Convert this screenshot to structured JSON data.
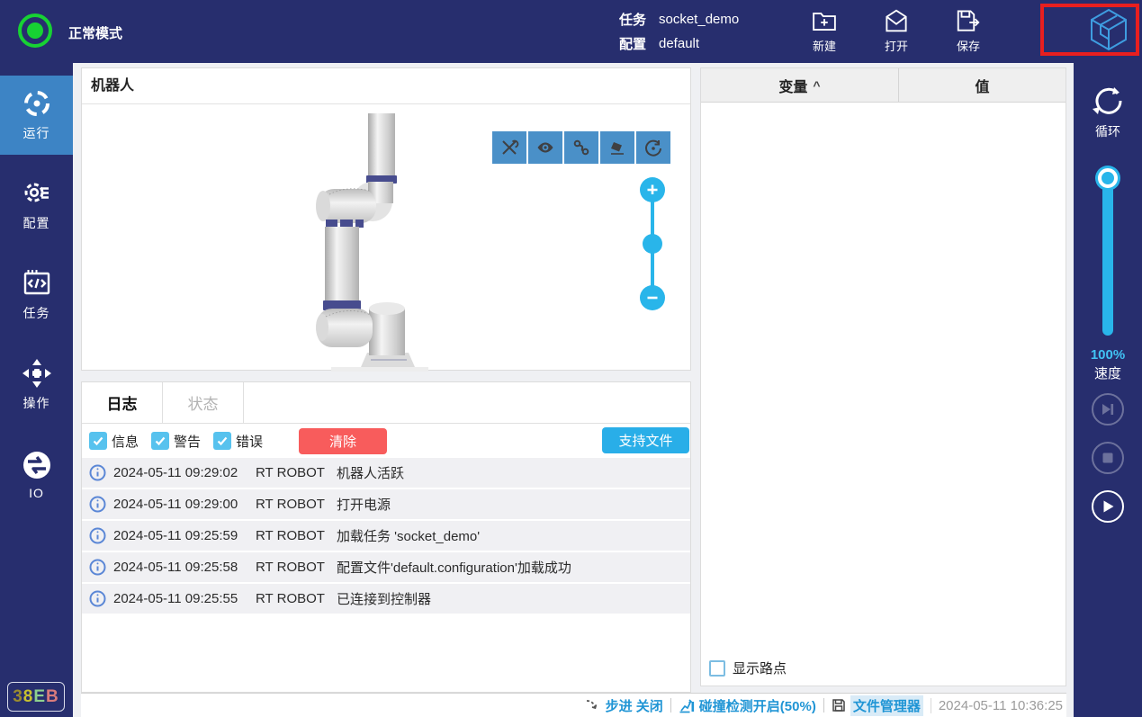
{
  "topbar": {
    "mode_label": "正常模式",
    "task_label": "任务",
    "task_value": "socket_demo",
    "config_label": "配置",
    "config_value": "default",
    "actions": [
      {
        "label": "新建"
      },
      {
        "label": "打开"
      },
      {
        "label": "保存"
      }
    ]
  },
  "sidebar": {
    "items": [
      {
        "label": "运行",
        "active": true
      },
      {
        "label": "配置",
        "active": false
      },
      {
        "label": "任务",
        "active": false
      },
      {
        "label": "操作",
        "active": false
      },
      {
        "label": "IO",
        "active": false
      }
    ],
    "code_chars": [
      {
        "ch": "3",
        "color": "#9a8b30"
      },
      {
        "ch": "8",
        "color": "#c9c22f"
      },
      {
        "ch": "E",
        "color": "#8ed08e"
      },
      {
        "ch": "B",
        "color": "#d97c7c"
      }
    ]
  },
  "robot_panel": {
    "title": "机器人",
    "toolbar_icons": [
      "tools",
      "eye",
      "path",
      "eraser",
      "rotate"
    ]
  },
  "log_panel": {
    "tabs": [
      {
        "label": "日志",
        "active": true
      },
      {
        "label": "状态",
        "active": false
      }
    ],
    "filters": [
      {
        "label": "信息",
        "checked": true
      },
      {
        "label": "警告",
        "checked": true
      },
      {
        "label": "错误",
        "checked": true
      }
    ],
    "clear_label": "清除",
    "support_label": "支持文件",
    "rows": [
      {
        "time": "2024-05-11 09:29:02",
        "source": "RT ROBOT",
        "message": "机器人活跃"
      },
      {
        "time": "2024-05-11 09:29:00",
        "source": "RT ROBOT",
        "message": "打开电源"
      },
      {
        "time": "2024-05-11 09:25:59",
        "source": "RT ROBOT",
        "message": "加载任务 'socket_demo'"
      },
      {
        "time": "2024-05-11 09:25:58",
        "source": "RT ROBOT",
        "message": "配置文件'default.configuration'加载成功"
      },
      {
        "time": "2024-05-11 09:25:55",
        "source": "RT ROBOT",
        "message": "已连接到控制器"
      }
    ]
  },
  "variables_panel": {
    "col_variable": "变量",
    "sort_indicator": "^",
    "col_value": "值",
    "show_waypoints_label": "显示路点",
    "show_waypoints_checked": false
  },
  "right_sidebar": {
    "loop_label": "循环",
    "speed_percent": "100%",
    "speed_label": "速度"
  },
  "statusbar": {
    "step_label": "步进 关闭",
    "collision_label": "碰撞检测开启(50%)",
    "file_manager_label": "文件管理器",
    "timestamp": "2024-05-11 10:36:25"
  },
  "colors": {
    "navy": "#272e6e",
    "active_blue": "#3d84c5",
    "toolbar_blue": "#4a90c8",
    "cyan": "#29b5ea",
    "red_button": "#f85c5c",
    "status_green": "#17d233",
    "highlight_red": "#e81f1f",
    "link_blue": "#2095d5"
  }
}
